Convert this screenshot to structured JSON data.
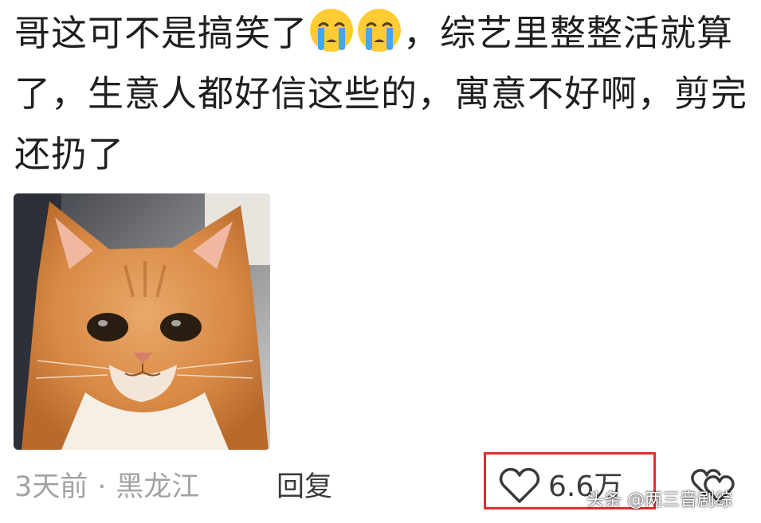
{
  "comment": {
    "text_part1": "哥这可不是搞笑了",
    "text_part2": "，综艺里整整活就算了，生意人都好信这些的，寓意不好啊，剪完还扔了",
    "emojis": [
      "crying-face-emoji",
      "crying-face-emoji"
    ]
  },
  "image": {
    "subject": "cat-sad-face-image"
  },
  "meta": {
    "time": "3天前",
    "separator": "·",
    "location": "黑龙江",
    "reply_label": "回复"
  },
  "like": {
    "count": "6.6万",
    "icon": "heart-outline-icon",
    "highlight_color": "#e02e2e"
  },
  "more": {
    "icon": "double-heart-icon"
  },
  "watermark": {
    "text": "头条 @两三音剧综"
  }
}
